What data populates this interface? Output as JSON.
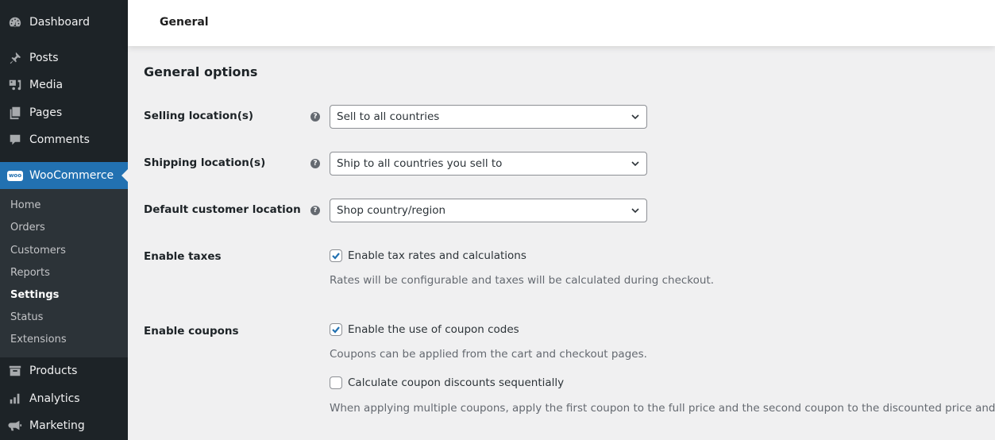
{
  "sidebar": {
    "top_items": [
      {
        "label": "Dashboard",
        "icon": "dashboard-icon"
      },
      {
        "label": "Posts",
        "icon": "pin-icon"
      },
      {
        "label": "Media",
        "icon": "media-icon"
      },
      {
        "label": "Pages",
        "icon": "pages-icon"
      },
      {
        "label": "Comments",
        "icon": "comment-icon"
      }
    ],
    "active_item": {
      "label": "WooCommerce",
      "icon": "woo-icon",
      "icon_text": "woo"
    },
    "submenu": [
      {
        "label": "Home"
      },
      {
        "label": "Orders"
      },
      {
        "label": "Customers"
      },
      {
        "label": "Reports"
      },
      {
        "label": "Settings",
        "current": true
      },
      {
        "label": "Status"
      },
      {
        "label": "Extensions"
      }
    ],
    "bottom_items": [
      {
        "label": "Products",
        "icon": "archive-icon"
      },
      {
        "label": "Analytics",
        "icon": "bar-chart-icon"
      },
      {
        "label": "Marketing",
        "icon": "megaphone-icon"
      }
    ]
  },
  "header": {
    "title": "General"
  },
  "main": {
    "section_title": "General options",
    "help_glyph": "?",
    "selects": [
      {
        "label": "Selling location(s)",
        "value": "Sell to all countries"
      },
      {
        "label": "Shipping location(s)",
        "value": "Ship to all countries you sell to"
      },
      {
        "label": "Default customer location",
        "value": "Shop country/region"
      }
    ],
    "taxes": {
      "label": "Enable taxes",
      "checkbox_label": "Enable tax rates and calculations",
      "checked": true,
      "description": "Rates will be configurable and taxes will be calculated during checkout."
    },
    "coupons": {
      "label": "Enable coupons",
      "checkbox_label": "Enable the use of coupon codes",
      "checked": true,
      "description": "Coupons can be applied from the cart and checkout pages.",
      "sequential_label": "Calculate coupon discounts sequentially",
      "sequential_checked": false,
      "sequential_description": "When applying multiple coupons, apply the first coupon to the full price and the second coupon to the discounted price and so on."
    }
  }
}
